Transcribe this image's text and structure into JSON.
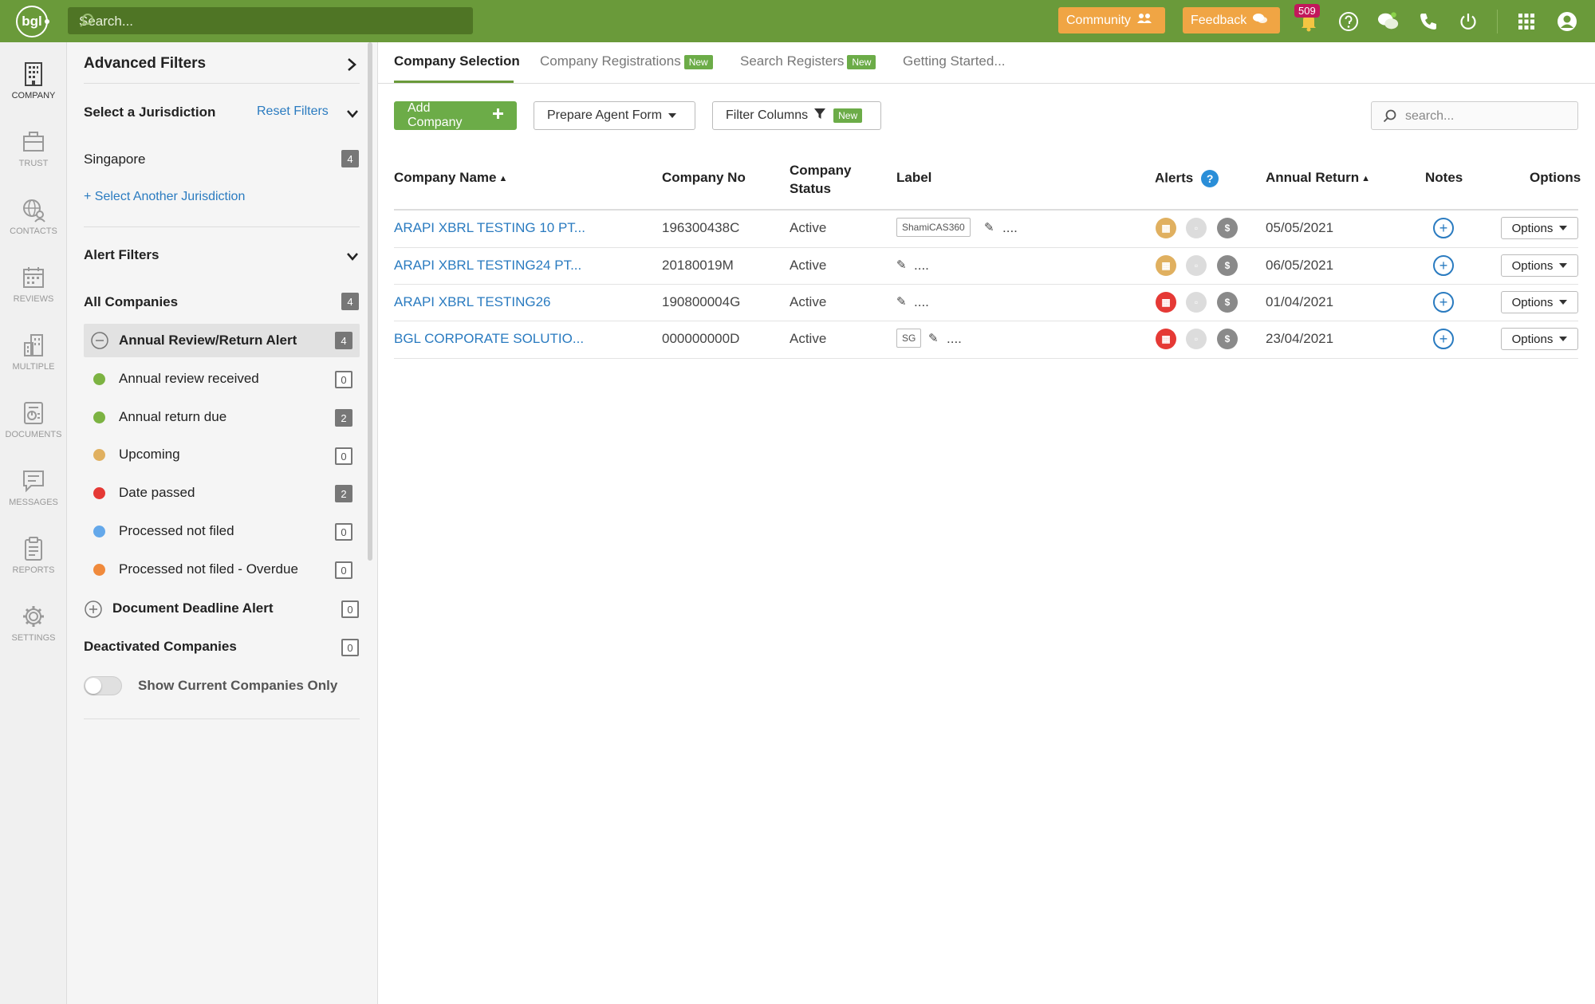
{
  "topbar": {
    "logo": "bgl",
    "search_placeholder": "Search...",
    "community_label": "Community",
    "feedback_label": "Feedback",
    "notification_count": "509"
  },
  "rail": [
    {
      "label": "COMPANY",
      "icon": "building-icon"
    },
    {
      "label": "TRUST",
      "icon": "briefcase-icon"
    },
    {
      "label": "CONTACTS",
      "icon": "globe-contacts-icon"
    },
    {
      "label": "REVIEWS",
      "icon": "calendar-icon"
    },
    {
      "label": "MULTIPLE",
      "icon": "multiple-buildings-icon"
    },
    {
      "label": "DOCUMENTS",
      "icon": "documents-icon"
    },
    {
      "label": "MESSAGES",
      "icon": "messages-icon"
    },
    {
      "label": "REPORTS",
      "icon": "clipboard-icon"
    },
    {
      "label": "SETTINGS",
      "icon": "gear-icon"
    }
  ],
  "filters": {
    "title": "Advanced Filters",
    "jurisdiction_label": "Select a Jurisdiction",
    "reset_label": "Reset Filters",
    "jurisdiction": {
      "name": "Singapore",
      "count": "4"
    },
    "add_jurisdiction": "+ Select Another Jurisdiction",
    "alert_filters_label": "Alert Filters",
    "all_companies": {
      "label": "All Companies",
      "count": "4"
    },
    "annual_alert": {
      "label": "Annual Review/Return Alert",
      "count": "4"
    },
    "sub_alerts": [
      {
        "label": "Annual review received",
        "count": "0",
        "color": "#7cb342"
      },
      {
        "label": "Annual return due",
        "count": "2",
        "color": "#7cb342"
      },
      {
        "label": "Upcoming",
        "count": "0",
        "color": "#e0b060"
      },
      {
        "label": "Date passed",
        "count": "2",
        "color": "#e53935"
      },
      {
        "label": "Processed not filed",
        "count": "0",
        "color": "#64a8ea"
      },
      {
        "label": "Processed not filed - Overdue",
        "count": "0",
        "color": "#f08a3c"
      }
    ],
    "document_alert": {
      "label": "Document Deadline Alert",
      "count": "0"
    },
    "deactivated": {
      "label": "Deactivated Companies",
      "count": "0"
    },
    "toggle_label": "Show Current Companies Only"
  },
  "tabs": [
    {
      "label": "Company Selection",
      "new": false
    },
    {
      "label": "Company Registrations",
      "new": true
    },
    {
      "label": "Search Registers",
      "new": true
    },
    {
      "label": "Getting Started...",
      "new": false
    }
  ],
  "new_tag": "New",
  "toolbar": {
    "add_company": "Add Company",
    "prepare_agent_form": "Prepare Agent Form",
    "filter_columns": "Filter Columns",
    "search_placeholder": "search..."
  },
  "table": {
    "headers": {
      "name": "Company Name",
      "number": "Company No",
      "status_line1": "Company",
      "status_line2": "Status",
      "label": "Label",
      "alerts": "Alerts",
      "annual_return": "Annual Return",
      "notes": "Notes",
      "options": "Options"
    },
    "rows": [
      {
        "name": "ARAPI XBRL TESTING 10 PT...",
        "number": "196300438C",
        "status": "Active",
        "label": "ShamiCAS360",
        "annual_return": "05/05/2021",
        "alert_color": "#e0b060",
        "options": "Options"
      },
      {
        "name": "ARAPI XBRL TESTING24 PT...",
        "number": "20180019M",
        "status": "Active",
        "label": "",
        "annual_return": "06/05/2021",
        "alert_color": "#e0b060",
        "options": "Options"
      },
      {
        "name": "ARAPI XBRL TESTING26",
        "number": "190800004G",
        "status": "Active",
        "label": "",
        "annual_return": "01/04/2021",
        "alert_color": "#e53935",
        "options": "Options"
      },
      {
        "name": "BGL CORPORATE SOLUTIO...",
        "number": "000000000D",
        "status": "Active",
        "label": "SG",
        "annual_return": "23/04/2021",
        "alert_color": "#e53935",
        "options": "Options"
      }
    ],
    "label_dots": "...."
  },
  "colors": {
    "brand_green": "#6a9a3a",
    "button_green": "#6cac48",
    "link_blue": "#2a7bc0",
    "orange": "#f0a544"
  }
}
